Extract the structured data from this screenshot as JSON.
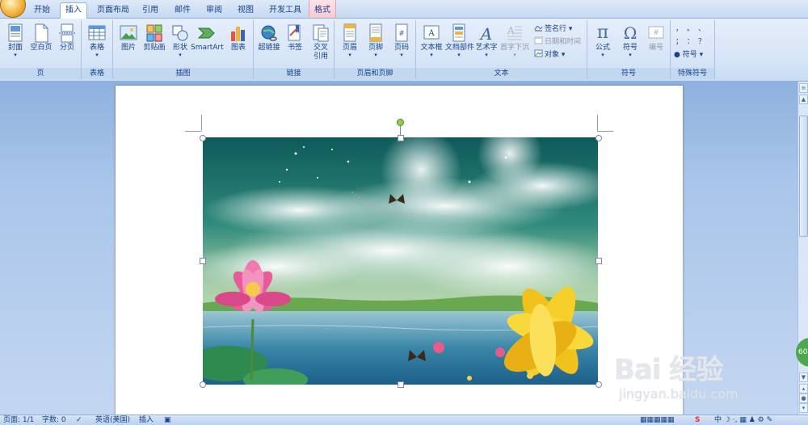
{
  "tabs": [
    "开始",
    "插入",
    "页面布局",
    "引用",
    "邮件",
    "审阅",
    "视图",
    "开发工具",
    "格式"
  ],
  "ribbon": {
    "groups": {
      "page": "页",
      "table": "表格",
      "illustrations": "插图",
      "links": "链接",
      "header_footer": "页眉和页脚",
      "text": "文本",
      "symbols": "符号",
      "special": "特殊符号"
    },
    "buttons": {
      "cover": "封面",
      "blank_page": "空白页",
      "page_break": "分页",
      "table": "表格",
      "picture": "图片",
      "clip_art": "剪贴画",
      "shapes": "形状",
      "smartart": "SmartArt",
      "chart": "图表",
      "hyperlink": "超链接",
      "bookmark": "书签",
      "cross_ref_1": "交叉",
      "cross_ref_2": "引用",
      "header": "页眉",
      "footer": "页脚",
      "page_number": "页码",
      "textbox": "文本框",
      "quick_parts": "文档部件",
      "wordart": "艺术字",
      "dropcap": "首字下沉",
      "signature": "签名行",
      "datetime": "日期和时间",
      "object": "对象",
      "equation": "公式",
      "symbol": "符号",
      "numbering": "编号",
      "special_symbol": "符号"
    },
    "special_marks": [
      "，",
      "。",
      "、",
      "；",
      "：",
      "？"
    ]
  },
  "status": {
    "page": "页面: 1/1",
    "words": "字数: 0",
    "language": "英语(美国)",
    "mode": "插入"
  },
  "watermark": {
    "logo": "Bai 经验",
    "url": "jingyan.baidu.com"
  },
  "badge": "60",
  "colors": {
    "accent": "#15428b",
    "ribbon": "#d6e4f7",
    "doc_bg": "#a9c5ea",
    "context_tab": "#f7c9d2"
  }
}
